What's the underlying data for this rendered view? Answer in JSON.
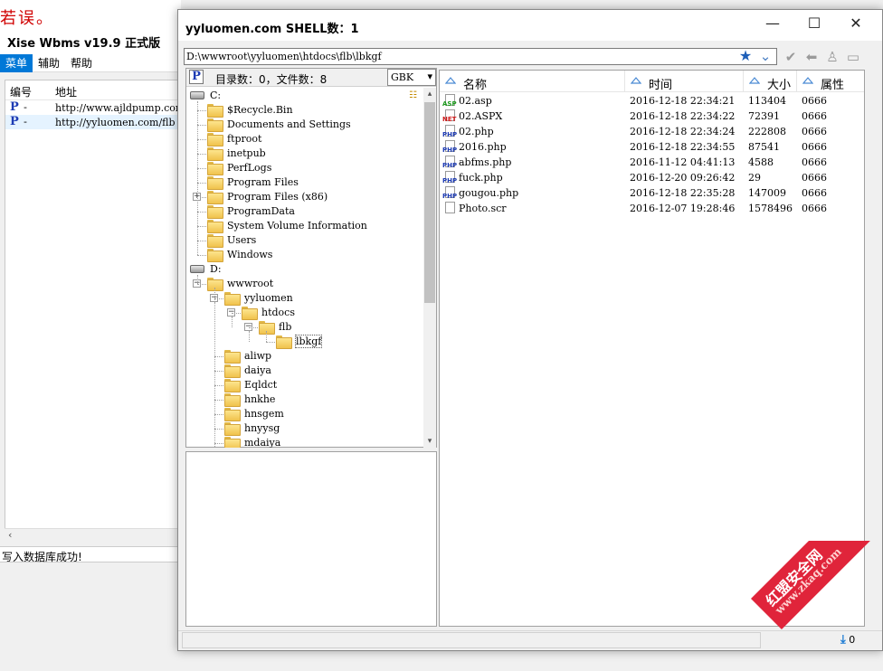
{
  "background_app": {
    "top_red_text": "若误。",
    "title": "Xise Wbms v19.9 正式版",
    "menu": [
      "菜单",
      "辅助",
      "帮助"
    ],
    "columns": [
      "编号",
      "地址"
    ],
    "rows": [
      {
        "id": "-",
        "url": "http://www.ajldpump.com"
      },
      {
        "id": "-",
        "url": "http://yyluomen.com/flb"
      }
    ],
    "status": "写入数据库成功!"
  },
  "shell": {
    "title": "yyluomen.com SHELL数：1",
    "path": "D:\\wwwroot\\yyluomen\\htdocs\\flb\\lbkgf",
    "summary": "目录数：0，文件数：8",
    "encoding": "GBK",
    "tree": {
      "drive_c": "C:",
      "c_items": [
        "$Recycle.Bin",
        "Documents and Settings",
        "ftproot",
        "inetpub",
        "PerfLogs",
        "Program Files",
        "Program Files (x86)",
        "ProgramData",
        "System Volume Information",
        "Users",
        "Windows"
      ],
      "drive_d": "D:",
      "wwwroot": "wwwroot",
      "yyluomen": "yyluomen",
      "htdocs": "htdocs",
      "flb": "flb",
      "lbkgf": "lbkgf",
      "wwwroot_children": [
        "aliwp",
        "daiya",
        "Eqldct",
        "hnkhe",
        "hnsgem",
        "hnyysg",
        "mdaiya"
      ]
    },
    "file_columns": [
      "名称",
      "时间",
      "大小",
      "属性"
    ],
    "files": [
      {
        "name": "02.asp",
        "time": "2016-12-18 22:34:21",
        "size": "113404",
        "attr": "0666",
        "type": "ASP",
        "color": "#1a9a1a"
      },
      {
        "name": "02.ASPX",
        "time": "2016-12-18 22:34:22",
        "size": "72391",
        "attr": "0666",
        "type": "NET",
        "color": "#d01818"
      },
      {
        "name": "02.php",
        "time": "2016-12-18 22:34:24",
        "size": "222808",
        "attr": "0666",
        "type": "PHP",
        "color": "#1e3cb4"
      },
      {
        "name": "2016.php",
        "time": "2016-12-18 22:34:55",
        "size": "87541",
        "attr": "0666",
        "type": "PHP",
        "color": "#1e3cb4"
      },
      {
        "name": "abfms.php",
        "time": "2016-11-12 04:41:13",
        "size": "4588",
        "attr": "0666",
        "type": "PHP",
        "color": "#1e3cb4"
      },
      {
        "name": "fuck.php",
        "time": "2016-12-20 09:26:42",
        "size": "29",
        "attr": "0666",
        "type": "PHP",
        "color": "#1e3cb4"
      },
      {
        "name": "gougou.php",
        "time": "2016-12-18 22:35:28",
        "size": "147009",
        "attr": "0666",
        "type": "PHP",
        "color": "#1e3cb4"
      },
      {
        "name": "Photo.scr",
        "time": "2016-12-07 19:28:46",
        "size": "1578496",
        "attr": "0666",
        "type": "",
        "color": "#555555"
      }
    ],
    "download_count": "0"
  },
  "watermark": {
    "line1": "红盟安全网",
    "line2": "www.zkaq.com"
  }
}
